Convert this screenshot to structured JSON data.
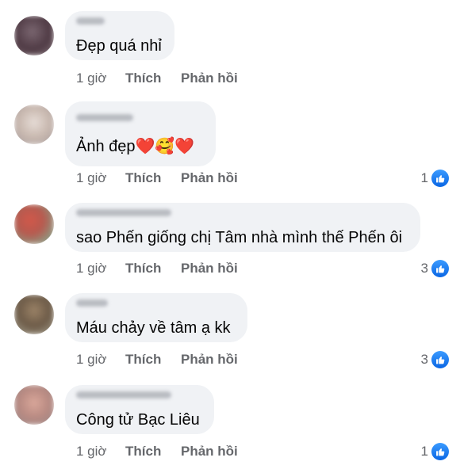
{
  "actions": {
    "like_label": "Thích",
    "reply_label": "Phản hồi"
  },
  "comments": [
    {
      "text": "Đẹp quá nhỉ",
      "time": "1 giờ",
      "reaction_count": ""
    },
    {
      "text": "Ảnh đẹp",
      "emoji": "❤️🥰❤️",
      "time": "1 giờ",
      "reaction_count": "1"
    },
    {
      "text": "sao Phến giống chị Tâm nhà mình thế Phến ôi",
      "time": "1 giờ",
      "reaction_count": "3"
    },
    {
      "text": "Máu chảy về tâm ạ kk",
      "time": "1 giờ",
      "reaction_count": "3"
    },
    {
      "text": "Công tử Bạc Liêu",
      "time": "1 giờ",
      "reaction_count": "1"
    }
  ],
  "colors": {
    "bubble": "#f0f2f5",
    "like_blue": "#1877f2",
    "meta_gray": "#65676b"
  }
}
